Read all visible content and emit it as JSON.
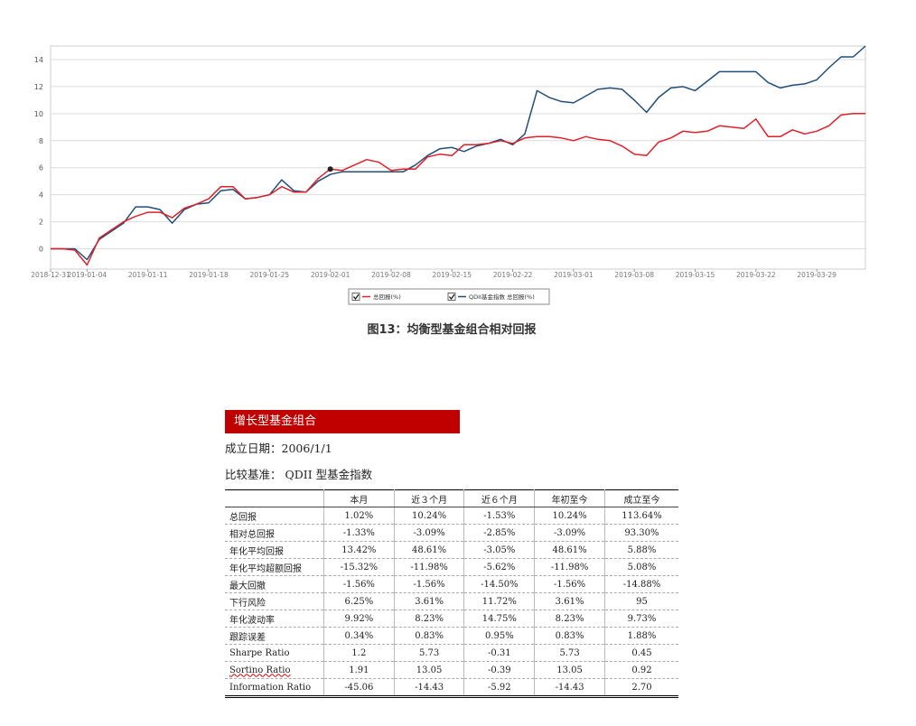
{
  "chart_data": {
    "type": "line",
    "x_ticks": [
      "2018-12-31",
      "2019-01-04",
      "2019-01-11",
      "2019-01-18",
      "2019-01-25",
      "2019-02-01",
      "2019-02-08",
      "2019-02-15",
      "2019-02-22",
      "2019-03-01",
      "2019-03-08",
      "2019-03-15",
      "2019-03-22",
      "2019-03-29"
    ],
    "tick_index": [
      0,
      3,
      8,
      13,
      18,
      23,
      28,
      33,
      38,
      43,
      48,
      53,
      58,
      63
    ],
    "ylim": [
      -1.5,
      15
    ],
    "yticks": [
      0,
      2,
      4,
      6,
      8,
      10,
      12,
      14
    ],
    "grid": true,
    "legend_position": "bottom-center",
    "series": [
      {
        "name": "总回报(%)",
        "color": "#e0202a",
        "values": [
          0,
          0,
          -0.1,
          -1.2,
          0.8,
          1.4,
          2.0,
          2.4,
          2.7,
          2.7,
          2.3,
          3.0,
          3.3,
          3.7,
          4.6,
          4.6,
          3.7,
          3.8,
          4.0,
          4.6,
          4.2,
          4.2,
          5.2,
          5.9,
          5.8,
          6.2,
          6.6,
          6.4,
          5.8,
          5.9,
          5.9,
          6.8,
          7.0,
          6.9,
          7.7,
          7.7,
          7.8,
          8.0,
          7.8,
          8.2,
          8.3,
          8.3,
          8.2,
          8.0,
          8.3,
          8.1,
          8.0,
          7.6,
          7.0,
          6.9,
          7.9,
          8.2,
          8.7,
          8.6,
          8.7,
          9.1,
          9.0,
          8.9,
          9.6,
          8.3,
          8.3,
          8.8,
          8.5,
          8.7,
          9.1,
          9.9,
          10.0,
          10.0
        ]
      },
      {
        "name": "QDII基金指数 总回报(%)",
        "color": "#1f4e79",
        "values": [
          0,
          0,
          0,
          -0.8,
          0.7,
          1.3,
          1.9,
          3.1,
          3.1,
          2.9,
          1.9,
          2.9,
          3.3,
          3.4,
          4.3,
          4.4,
          3.7,
          3.8,
          4.0,
          5.1,
          4.3,
          4.2,
          5.0,
          5.5,
          5.7,
          5.7,
          5.7,
          5.7,
          5.7,
          5.7,
          6.2,
          6.9,
          7.4,
          7.5,
          7.2,
          7.6,
          7.8,
          8.1,
          7.7,
          8.5,
          11.7,
          11.2,
          10.9,
          10.8,
          11.3,
          11.8,
          11.9,
          11.8,
          11.0,
          10.1,
          11.2,
          11.9,
          12.0,
          11.7,
          12.4,
          13.1,
          13.1,
          13.1,
          13.1,
          12.3,
          11.9,
          12.1,
          12.2,
          12.5,
          13.4,
          14.2,
          14.2,
          15.0
        ]
      }
    ],
    "marker": {
      "series": 0,
      "index": 23
    }
  },
  "caption": "图13：均衡型基金组合相对回报",
  "fund": {
    "name": "增长型基金组合",
    "inception_label": "成立日期：",
    "inception_date": "2006/1/1",
    "benchmark_label": "比较基准：",
    "benchmark": "QDII 型基金指数"
  },
  "table": {
    "headers": [
      "",
      "本月",
      "近３个月",
      "近６个月",
      "年初至今",
      "成立至今"
    ],
    "rows": [
      [
        "总回报",
        "1.02%",
        "10.24%",
        "-1.53%",
        "10.24%",
        "113.64%"
      ],
      [
        "相对总回报",
        "-1.33%",
        "-3.09%",
        "-2.85%",
        "-3.09%",
        "93.30%"
      ],
      [
        "年化平均回报",
        "13.42%",
        "48.61%",
        "-3.05%",
        "48.61%",
        "5.88%"
      ],
      [
        "年化平均超额回报",
        "-15.32%",
        "-11.98%",
        "-5.62%",
        "-11.98%",
        "5.08%"
      ],
      [
        "最大回撤",
        "-1.56%",
        "-1.56%",
        "-14.50%",
        "-1.56%",
        "-14.88%"
      ],
      [
        "下行风险",
        "6.25%",
        "3.61%",
        "11.72%",
        "3.61%",
        "95"
      ],
      [
        "年化波动率",
        "9.92%",
        "8.23%",
        "14.75%",
        "8.23%",
        "9.73%"
      ],
      [
        "跟踪误差",
        "0.34%",
        "0.83%",
        "0.95%",
        "0.83%",
        "1.88%"
      ],
      [
        "Sharpe Ratio",
        "1.2",
        "5.73",
        "-0.31",
        "5.73",
        "0.45"
      ],
      [
        "Sortino Ratio",
        "1.91",
        "13.05",
        "-0.39",
        "13.05",
        "0.92"
      ],
      [
        "Information Ratio",
        "-45.06",
        "-14.43",
        "-5.92",
        "-14.43",
        "2.70"
      ]
    ]
  }
}
